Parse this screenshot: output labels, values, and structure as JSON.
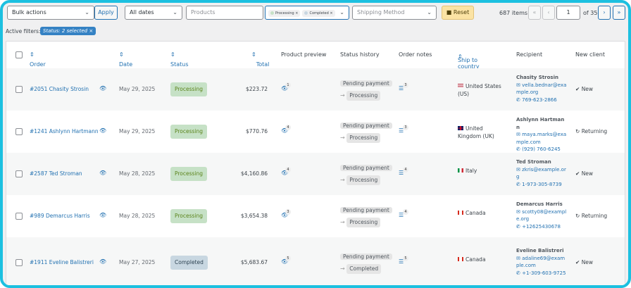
{
  "toolbar": {
    "bulk_actions": "Bulk actions",
    "apply": "Apply",
    "dates": "All dates",
    "products_placeholder": "Products",
    "status_chips": [
      "Processing",
      "Completed"
    ],
    "shipping_placeholder": "Shipping Method",
    "reset": "Reset",
    "items_count": "687 items",
    "first": "«",
    "prev": "‹",
    "page": "1",
    "of_pages": "of 35",
    "next": "›",
    "last": "»"
  },
  "filters": {
    "label": "Active filters:",
    "chip": "Status: 2 selected ×"
  },
  "columns": {
    "order": "Order",
    "date": "Date",
    "status": "Status",
    "total": "Total",
    "preview": "Product preview",
    "history": "Status history",
    "notes": "Order notes",
    "ship": "Ship to country",
    "recipient": "Recipient",
    "client": "New client"
  },
  "colors": {
    "accent": "#2271b1",
    "processing": "#c6e1c6",
    "completed": "#c8d7e1",
    "frame": "#1cc0e0"
  },
  "orders": [
    {
      "order": "#2051 Chasity Strosin",
      "date": "May 29, 2025",
      "status": "Processing",
      "total": "$223.72",
      "preview_count": "1",
      "history_from": "Pending payment",
      "history_to": "Processing",
      "notes_count": "3",
      "country": "United States (US)",
      "flag": "us",
      "name": "Chasity Strosin",
      "email": "vella.bednar@example.org",
      "phone": "769-623-2866",
      "client": "New",
      "client_icon": "check"
    },
    {
      "order": "#1241 Ashlynn Hartmann",
      "date": "May 29, 2025",
      "status": "Processing",
      "total": "$770.76",
      "preview_count": "4",
      "history_from": "Pending payment",
      "history_to": "Processing",
      "notes_count": "3",
      "country": "United Kingdom (UK)",
      "flag": "uk",
      "name": "Ashlynn Hartmann",
      "email": "maya.marks@example.com",
      "phone": "(929) 760-6245",
      "client": "Returning",
      "client_icon": "refresh"
    },
    {
      "order": "#2587 Ted Stroman",
      "date": "May 28, 2025",
      "status": "Processing",
      "total": "$4,160.86",
      "preview_count": "4",
      "history_from": "Pending payment",
      "history_to": "Processing",
      "notes_count": "4",
      "country": "Italy",
      "flag": "it",
      "name": "Ted Stroman",
      "email": "zkris@example.org",
      "phone": "1-973-305-8739",
      "client": "New",
      "client_icon": "check"
    },
    {
      "order": "#989 Demarcus Harris",
      "date": "May 28, 2025",
      "status": "Processing",
      "total": "$3,654.38",
      "preview_count": "3",
      "history_from": "Pending payment",
      "history_to": "Processing",
      "notes_count": "4",
      "country": "Canada",
      "flag": "ca",
      "name": "Demarcus Harris",
      "email": "scotty08@example.org",
      "phone": "+12625430678",
      "client": "Returning",
      "client_icon": "refresh"
    },
    {
      "order": "#1911 Eveline Balistreri",
      "date": "May 27, 2025",
      "status": "Completed",
      "total": "$5,683.67",
      "preview_count": "5",
      "history_from": "Pending payment",
      "history_to": "Completed",
      "notes_count": "5",
      "country": "Canada",
      "flag": "ca",
      "name": "Eveline Balistreri",
      "email": "adaline69@example.com",
      "phone": "+1-309-603-9725",
      "client": "New",
      "client_icon": "check"
    }
  ]
}
